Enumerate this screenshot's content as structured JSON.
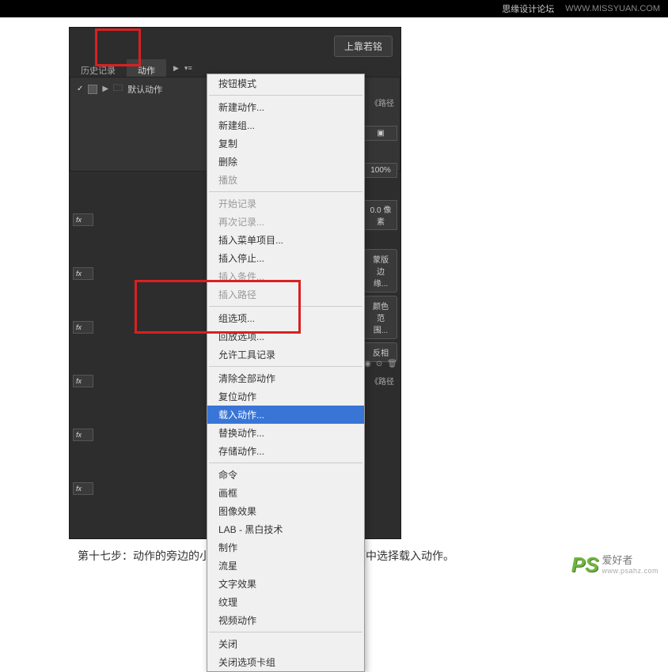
{
  "header": {
    "forum": "思缘设计论坛",
    "url": "WWW.MISSYUAN.COM"
  },
  "toolbar_button": "上靠若铭",
  "tabs": {
    "history": "历史记录",
    "actions": "动作"
  },
  "action_item": "默认动作",
  "menu": {
    "button_mode": "按钮模式",
    "new_action": "新建动作...",
    "new_set": "新建组...",
    "duplicate": "复制",
    "delete": "删除",
    "play": "播放",
    "start_record": "开始记录",
    "record_again": "再次记录...",
    "insert_menu": "插入菜单项目...",
    "insert_stop": "插入停止...",
    "insert_cond": "插入条件...",
    "insert_path": "插入路径",
    "set_options": "组选项...",
    "play_options": "回放选项...",
    "allow_tool_record": "允许工具记录",
    "clear_all": "清除全部动作",
    "reset": "复位动作",
    "load": "载入动作...",
    "replace": "替换动作...",
    "save": "存储动作...",
    "commands": "命令",
    "frames": "画框",
    "image_effects": "图像效果",
    "lab": "LAB - 黑白技术",
    "production": "制作",
    "stars": "流星",
    "text_effects": "文字效果",
    "textures": "纹理",
    "video_actions": "视频动作",
    "close": "关闭",
    "close_tab_group": "关闭选项卡组"
  },
  "right": {
    "paths": "《路径",
    "percent": "100%",
    "pixels": "0.0 像素",
    "refine_edge": "蒙版边缘...",
    "color_range": "颜色范围...",
    "invert": "反相",
    "paths2": "《路径"
  },
  "fx": "fx",
  "caption": "第十七步：动作的旁边的小三角形，点一下，在弹出的选项中选择载入动作。",
  "watermark": {
    "logo": "PS",
    "cn": "爱好者",
    "url": "www.psahz.com"
  }
}
